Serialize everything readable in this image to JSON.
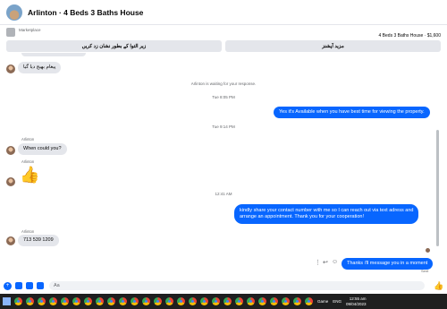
{
  "header": {
    "title": "Arlinton · 4 Beds 3 Baths House"
  },
  "marketplace": {
    "label": "Marketplace",
    "listing": "4 Beds 3 Baths House · $1,600",
    "buttons": [
      "زیر التوا کے بطور نشان زد کریں",
      "مزید آپشنز"
    ]
  },
  "messages": {
    "m1": "پیغام بھیج دیا گیا",
    "notice": "Arlinton is waiting for your response.",
    "t1": "Tue 8:05 PM",
    "m2": "Yes it's Available when you have best time for viewing the property.",
    "t2": "Tue 9:14 PM",
    "sender": "Arlinton",
    "m3": "When could you?",
    "thumb": "👍",
    "t3": "12:41 AM",
    "m4_line1": "kindly share your contact number with me so I can reach out via text adress and",
    "m4_line2": "arrange an appointment. Thank you for your cooperation!",
    "m5": "713 539 1209",
    "m6": "Thanks i'll message you in a moment",
    "sent": "Sent"
  },
  "composer": {
    "placeholder": "Aa"
  },
  "taskbar": {
    "search_app": "Game",
    "lang": "ENG",
    "time": "12:55 am",
    "date": "09/04/2023"
  },
  "colors": {
    "accent": "#0866ff",
    "bubble_in": "#e4e6eb",
    "taskbar": "#1f1f1f"
  }
}
